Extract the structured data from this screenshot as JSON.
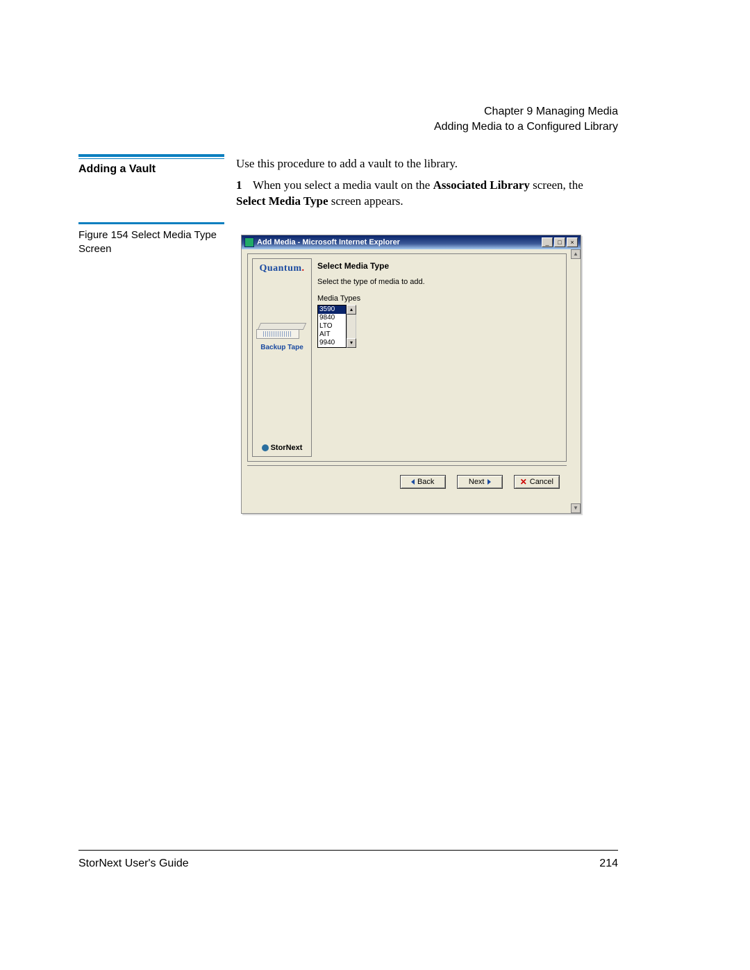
{
  "header": {
    "line1": "Chapter 9  Managing Media",
    "line2": "Adding Media to a Configured Library"
  },
  "section": {
    "heading": "Adding a Vault",
    "intro": "Use this procedure to add a vault to the library.",
    "step_num": "1",
    "step_text_a": "When you select a media vault on the ",
    "step_bold_a": "Associated Library",
    "step_text_b": " screen, the ",
    "step_bold_b": "Select Media Type",
    "step_text_c": " screen appears."
  },
  "figure": {
    "label": "Figure 154  Select Media Type Screen"
  },
  "window": {
    "title": "Add Media - Microsoft Internet Explorer",
    "btn_min": "_",
    "btn_max": "□",
    "btn_close": "×",
    "scroll_up": "▲",
    "scroll_dn": "▼"
  },
  "sidebar": {
    "logo_text": "Quantum",
    "logo_dot": ".",
    "caption": "Backup Tape",
    "brand": "StorNext"
  },
  "content": {
    "heading": "Select Media Type",
    "sub": "Select the type of media to add.",
    "label": "Media Types",
    "options": [
      "3590",
      "9840",
      "LTO",
      "AIT",
      "9940"
    ],
    "list_up": "▴",
    "list_dn": "▾"
  },
  "buttons": {
    "back": "Back",
    "next": "Next",
    "cancel": "Cancel",
    "x": "✕"
  },
  "footer": {
    "left": "StorNext User's Guide",
    "right": "214"
  }
}
